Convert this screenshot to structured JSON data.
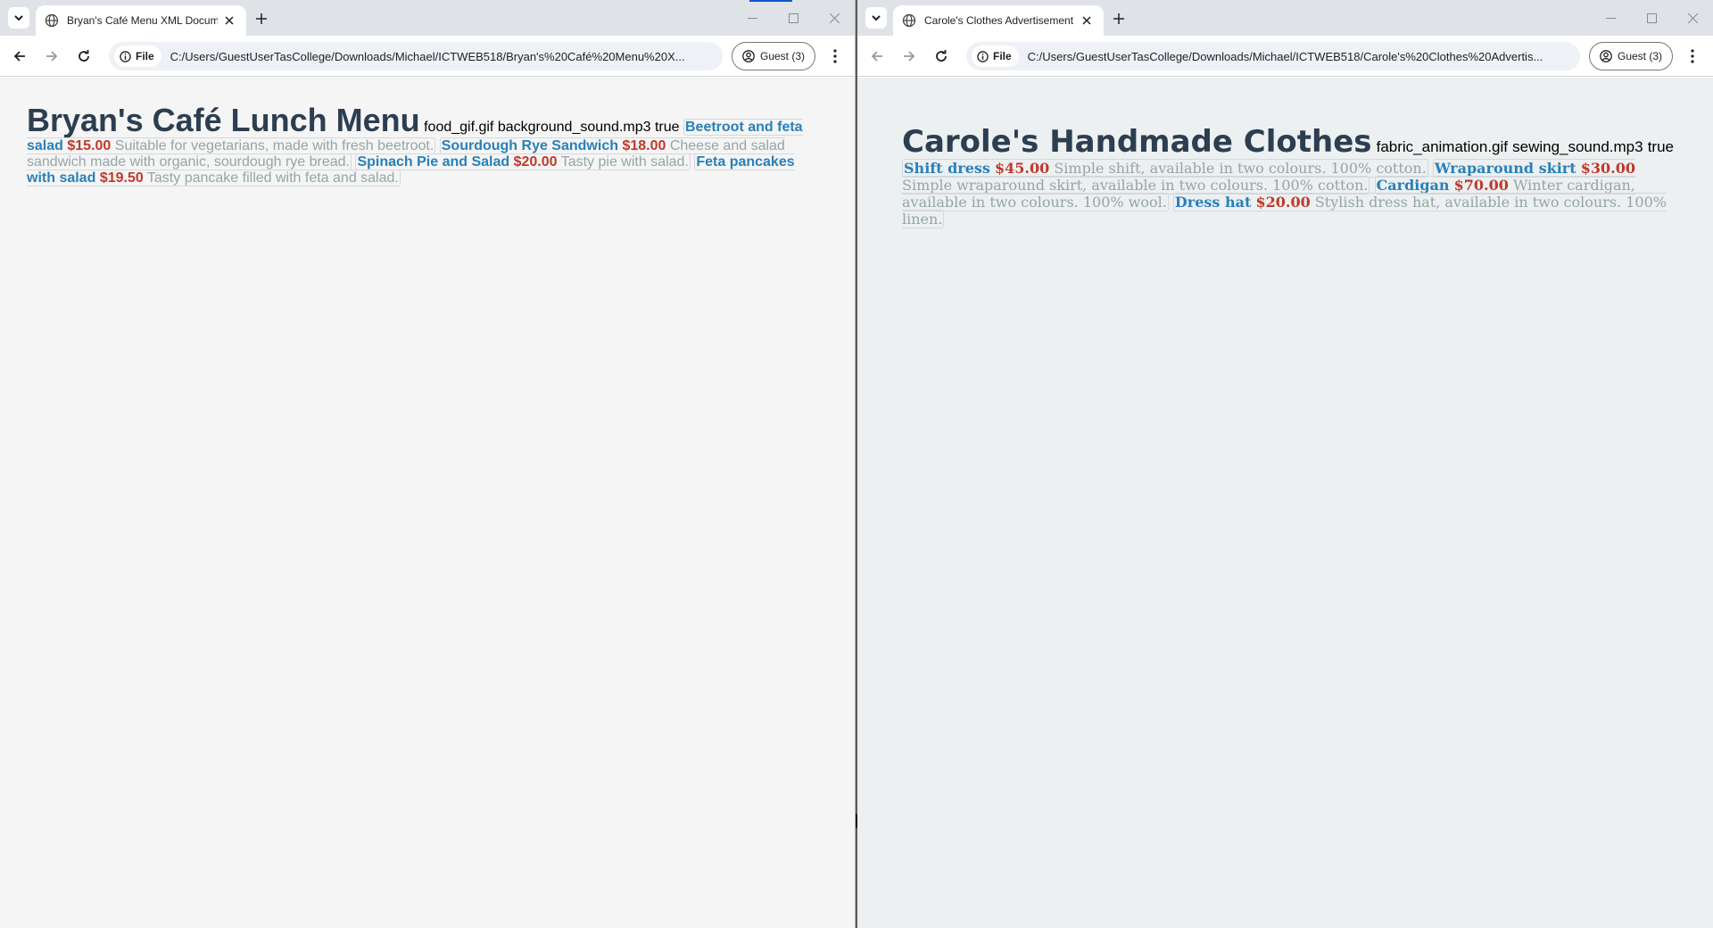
{
  "colors": {
    "heading": "#2c3e50",
    "item_name": "#2980b9",
    "item_price": "#c0392b",
    "item_desc": "#95a5a6"
  },
  "left": {
    "tab_title": "Bryan's Café Menu XML Docum",
    "address_chip": "File",
    "url": "C:/Users/GuestUserTasCollege/Downloads/Michael/ICTWEB518/Bryan's%20Café%20Menu%20X...",
    "profile_label": "Guest (3)",
    "page": {
      "heading": "Bryan's Café Lunch Menu",
      "image": "food_gif.gif",
      "sound": "background_sound.mp3",
      "flag": "true",
      "items": [
        {
          "name": "Beetroot and feta salad",
          "price": "$15.00",
          "desc": "Suitable for vegetarians, made with fresh beetroot."
        },
        {
          "name": "Sourdough Rye Sandwich",
          "price": "$18.00",
          "desc": "Cheese and salad sandwich made with organic, sourdough rye bread."
        },
        {
          "name": "Spinach Pie and Salad",
          "price": "$20.00",
          "desc": "Tasty pie with salad."
        },
        {
          "name": "Feta pancakes with salad",
          "price": "$19.50",
          "desc": "Tasty pancake filled with feta and salad."
        }
      ]
    }
  },
  "right": {
    "tab_title": "Carole's Clothes Advertisement",
    "address_chip": "File",
    "url": "C:/Users/GuestUserTasCollege/Downloads/Michael/ICTWEB518/Carole's%20Clothes%20Advertis...",
    "profile_label": "Guest (3)",
    "page": {
      "heading": "Carole's Handmade Clothes",
      "image": "fabric_animation.gif",
      "sound": "sewing_sound.mp3",
      "flag": "true",
      "items": [
        {
          "name": "Shift dress",
          "price": "$45.00",
          "desc": "Simple shift, available in two colours. 100% cotton."
        },
        {
          "name": "Wraparound skirt",
          "price": "$30.00",
          "desc": "Simple wraparound skirt, available in two colours. 100% cotton."
        },
        {
          "name": "Cardigan",
          "price": "$70.00",
          "desc": "Winter cardigan, available in two colours. 100% wool."
        },
        {
          "name": "Dress hat",
          "price": "$20.00",
          "desc": "Stylish dress hat, available in two colours. 100% linen."
        }
      ]
    }
  }
}
